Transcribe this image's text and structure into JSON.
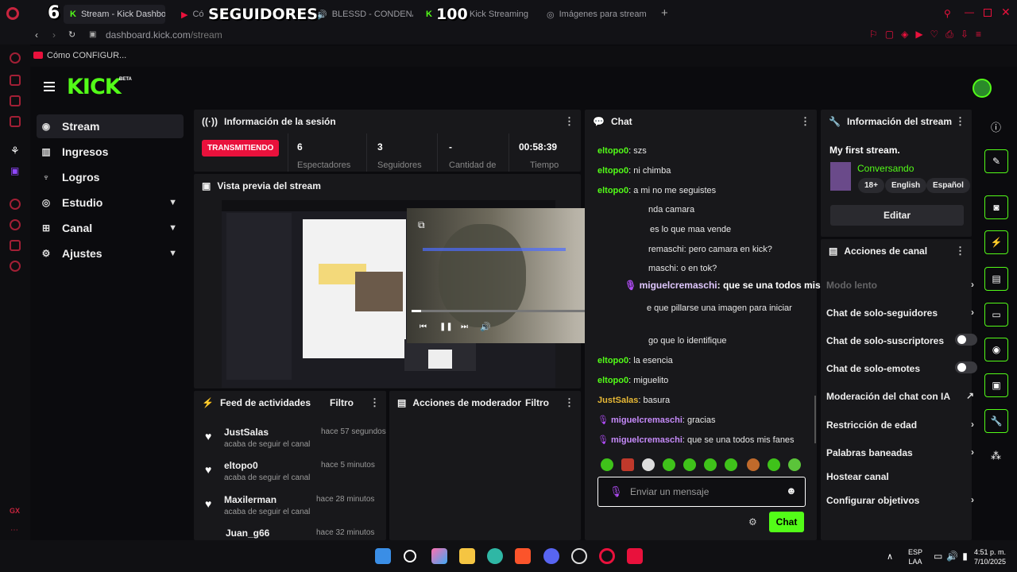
{
  "browser": {
    "tabs": [
      {
        "label": "Stream - Kick Dashbo",
        "active": true
      },
      {
        "label": "Có"
      },
      {
        "label": "BLESSD - CONDENA"
      },
      {
        "label": "- Kick Streaming"
      },
      {
        "label": "Imágenes para stream"
      }
    ],
    "overlay": {
      "left_num": "6",
      "seguidores": "SEGUIDORES",
      "right_num": "100"
    },
    "url_domain": "dashboard.kick.com",
    "url_path": "/stream",
    "bookmark": "Cómo CONFIGUR..."
  },
  "kick": {
    "logo": "KICK",
    "beta": "BETA",
    "nav": [
      {
        "label": "Stream",
        "active": true
      },
      {
        "label": "Ingresos"
      },
      {
        "label": "Logros"
      },
      {
        "label": "Estudio",
        "expandable": true
      },
      {
        "label": "Canal",
        "expandable": true
      },
      {
        "label": "Ajustes",
        "expandable": true
      }
    ],
    "session": {
      "title": "Información de la sesión",
      "badge": "TRANSMITIENDO",
      "viewers": "6",
      "viewers_label": "Espectadores",
      "followers": "3",
      "followers_label": "Seguidores",
      "amount": "-",
      "amount_label": "Cantidad de",
      "time": "00:58:39",
      "time_label": "Tiempo"
    },
    "preview": {
      "title": "Vista previa del stream"
    },
    "feed": {
      "title": "Feed de actividades",
      "filter": "Filtro",
      "items": [
        {
          "name": "JustSalas",
          "time": "hace 57 segundos",
          "sub": "acaba de seguir el canal"
        },
        {
          "name": "eltopo0",
          "time": "hace 5 minutos",
          "sub": "acaba de seguir el canal"
        },
        {
          "name": "Maxilerman",
          "time": "hace 28 minutos",
          "sub": "acaba de seguir el canal"
        },
        {
          "name": "Juan_g66",
          "time": "hace 32 minutos",
          "sub": ""
        }
      ]
    },
    "mod": {
      "title": "Acciones de moderador",
      "filter": "Filtro"
    },
    "chat": {
      "title": "Chat",
      "messages": [
        {
          "user": "eltopo0",
          "text": ": szs",
          "color": "g"
        },
        {
          "user": "eltopo0",
          "text": ": ni chimba",
          "color": "g"
        },
        {
          "user": "eltopo0",
          "text": ": a mi no me seguistes",
          "color": "g"
        },
        {
          "user": "",
          "text": "nda camara",
          "color": "g"
        },
        {
          "user": "",
          "text": "es lo que maa vende",
          "color": "g"
        },
        {
          "user": "",
          "text": "remaschi: pero camara en kick?",
          "color": "g"
        },
        {
          "user": "",
          "text": "maschi: o en tok?",
          "color": "g"
        },
        {
          "user": "",
          "text": "e que pillarse una imagen para iniciar",
          "color": "g"
        },
        {
          "user": "",
          "text": "go que lo identifique",
          "color": "g"
        },
        {
          "user": "eltopo0",
          "text": ": la esencia",
          "color": "g"
        },
        {
          "user": "eltopo0",
          "text": ": miguelito",
          "color": "g"
        },
        {
          "user": "JustSalas",
          "text": ": basura",
          "color": "y"
        },
        {
          "user": "miguelcremaschi",
          "text": ": gracias",
          "color": "p"
        },
        {
          "user": "miguelcremaschi",
          "text": ": que se una todos mis fanes",
          "color": "p"
        }
      ],
      "highlight": {
        "user": "miguelcremaschi",
        "text": ": que se una todos mis fanes"
      },
      "input_placeholder": "Enviar un mensaje",
      "send": "Chat"
    },
    "stream_info": {
      "title": "Información del stream",
      "stream_title": "My first stream.",
      "category": "Conversando",
      "tags": [
        "18+",
        "English",
        "Español"
      ],
      "edit": "Editar"
    },
    "channel_actions": {
      "title": "Acciones de canal",
      "items": [
        {
          "label": "Modo lento",
          "type": "arrow"
        },
        {
          "label": "Chat de solo-seguidores",
          "type": "arrow"
        },
        {
          "label": "Chat de solo-suscriptores",
          "type": "toggle"
        },
        {
          "label": "Chat de solo-emotes",
          "type": "toggle"
        },
        {
          "label": "Moderación del chat con IA",
          "type": "external"
        },
        {
          "label": "Restricción de edad",
          "type": "arrow"
        },
        {
          "label": "Palabras baneadas",
          "type": "arrow"
        },
        {
          "label": "Hostear canal",
          "type": "none"
        },
        {
          "label": "Configurar objetivos",
          "type": "arrow"
        }
      ]
    },
    "colors": {
      "accent": "#53fc18",
      "live": "#e9113c",
      "panel": "#18181b"
    }
  },
  "taskbar": {
    "lang1": "ESP",
    "lang2": "LAA",
    "time": "4:51 p. m.",
    "date": "7/10/2025"
  }
}
